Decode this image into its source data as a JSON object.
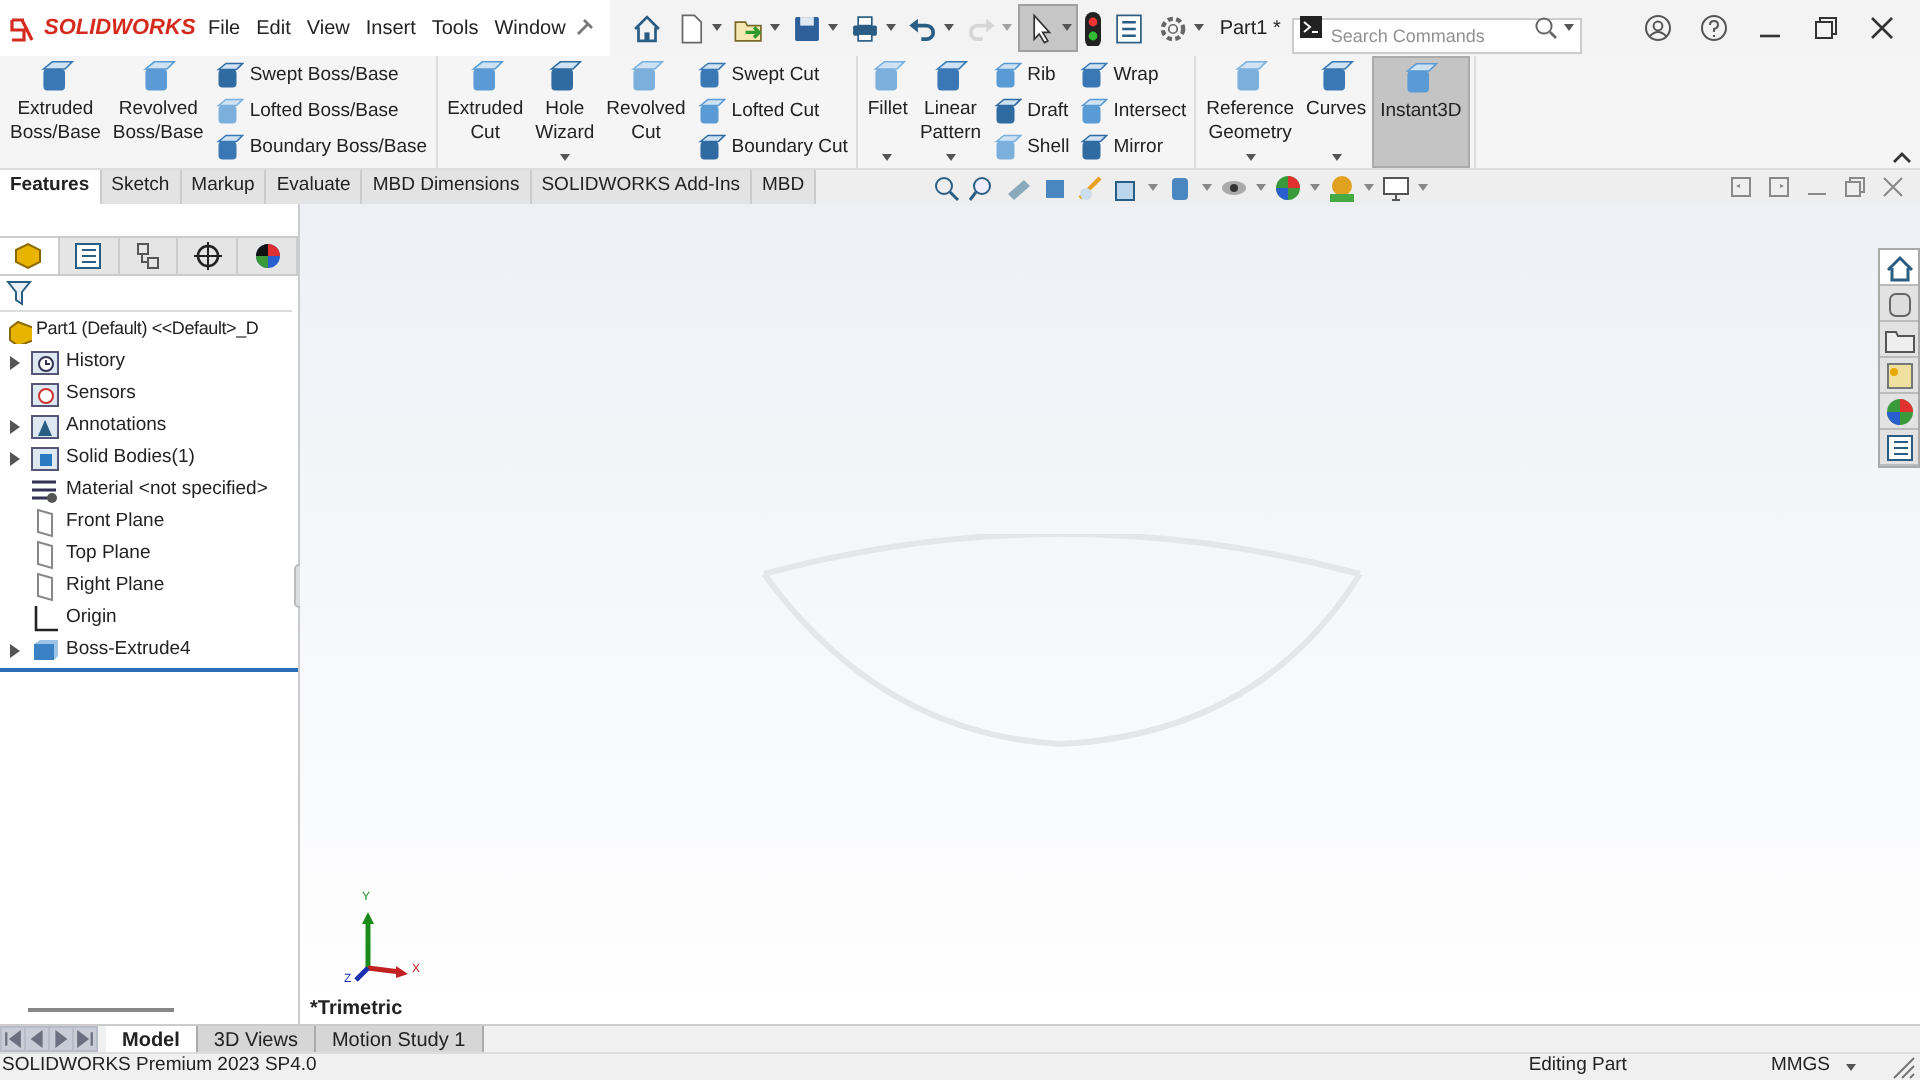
{
  "app": {
    "logo": "SOLIDWORKS"
  },
  "menu": [
    "File",
    "Edit",
    "View",
    "Insert",
    "Tools",
    "Window"
  ],
  "quick_access": [
    {
      "kind": "home",
      "pressed": false,
      "disabled": false,
      "dropdown": false
    },
    {
      "kind": "new",
      "pressed": false,
      "disabled": false,
      "dropdown": true
    },
    {
      "kind": "open",
      "pressed": false,
      "disabled": false,
      "dropdown": true
    },
    {
      "kind": "save",
      "pressed": false,
      "disabled": false,
      "dropdown": true
    },
    {
      "kind": "print",
      "pressed": false,
      "disabled": false,
      "dropdown": true
    },
    {
      "kind": "undo",
      "pressed": false,
      "disabled": false,
      "dropdown": true
    },
    {
      "kind": "redo",
      "pressed": false,
      "disabled": true,
      "dropdown": true
    },
    {
      "kind": "select",
      "pressed": true,
      "disabled": false,
      "dropdown": true
    },
    {
      "kind": "rebuild",
      "pressed": false,
      "disabled": false,
      "dropdown": false
    },
    {
      "kind": "properties",
      "pressed": false,
      "disabled": false,
      "dropdown": false
    },
    {
      "kind": "options",
      "pressed": false,
      "disabled": false,
      "dropdown": true
    }
  ],
  "document": "Part1 *",
  "search": {
    "placeholder": "Search Commands"
  },
  "ribbon": [
    {
      "items": [
        {
          "kind": "large",
          "lines": [
            "Extruded",
            "Boss/Base"
          ],
          "dropdown": false,
          "active": false
        },
        {
          "kind": "large",
          "lines": [
            "Revolved",
            "Boss/Base"
          ],
          "dropdown": false,
          "active": false
        },
        {
          "kind": "stack",
          "labels": [
            "Swept Boss/Base",
            "Lofted Boss/Base",
            "Boundary Boss/Base"
          ]
        }
      ]
    },
    {
      "items": [
        {
          "kind": "large",
          "lines": [
            "Extruded",
            "Cut"
          ],
          "dropdown": false,
          "active": false
        },
        {
          "kind": "large",
          "lines": [
            "Hole",
            "Wizard"
          ],
          "dropdown": true,
          "active": false
        },
        {
          "kind": "large",
          "lines": [
            "Revolved",
            "Cut"
          ],
          "dropdown": false,
          "active": false
        },
        {
          "kind": "stack",
          "labels": [
            "Swept Cut",
            "Lofted Cut",
            "Boundary Cut"
          ]
        }
      ]
    },
    {
      "items": [
        {
          "kind": "large",
          "lines": [
            "Fillet"
          ],
          "dropdown": true,
          "active": false
        },
        {
          "kind": "large",
          "lines": [
            "Linear",
            "Pattern"
          ],
          "dropdown": true,
          "active": false
        },
        {
          "kind": "stack",
          "labels": [
            "Rib",
            "Draft",
            "Shell"
          ]
        },
        {
          "kind": "stack",
          "labels": [
            "Wrap",
            "Intersect",
            "Mirror"
          ]
        }
      ]
    },
    {
      "items": [
        {
          "kind": "large",
          "lines": [
            "Reference",
            "Geometry"
          ],
          "dropdown": true,
          "active": false
        },
        {
          "kind": "large",
          "lines": [
            "Curves"
          ],
          "dropdown": true,
          "active": false
        },
        {
          "kind": "large",
          "lines": [
            "Instant3D"
          ],
          "dropdown": false,
          "active": true
        }
      ]
    }
  ],
  "tabs": [
    {
      "label": "Features",
      "selected": true
    },
    {
      "label": "Sketch",
      "selected": false
    },
    {
      "label": "Markup",
      "selected": false
    },
    {
      "label": "Evaluate",
      "selected": false
    },
    {
      "label": "MBD Dimensions",
      "selected": false
    },
    {
      "label": "SOLIDWORKS Add-Ins",
      "selected": false
    },
    {
      "label": "MBD",
      "selected": false
    }
  ],
  "panel_tabs": [
    {
      "kind": "feature",
      "selected": true
    },
    {
      "kind": "property",
      "selected": false
    },
    {
      "kind": "config",
      "selected": false
    },
    {
      "kind": "dim",
      "selected": false
    },
    {
      "kind": "display",
      "selected": false
    }
  ],
  "tree": {
    "root": "Part1 (Default) <<Default>_D",
    "items": [
      {
        "kind": "history",
        "label": "History",
        "expandable": true
      },
      {
        "kind": "sensor",
        "label": "Sensors",
        "expandable": false
      },
      {
        "kind": "annotation",
        "label": "Annotations",
        "expandable": true
      },
      {
        "kind": "body",
        "label": "Solid Bodies(1)",
        "expandable": true
      },
      {
        "kind": "material",
        "label": "Material <not specified>",
        "expandable": false
      },
      {
        "kind": "plane",
        "label": "Front Plane",
        "expandable": false
      },
      {
        "kind": "plane",
        "label": "Top Plane",
        "expandable": false
      },
      {
        "kind": "plane",
        "label": "Right Plane",
        "expandable": false
      },
      {
        "kind": "origin",
        "label": "Origin",
        "expandable": false
      },
      {
        "kind": "extrude",
        "label": "Boss-Extrude4",
        "expandable": true
      }
    ]
  },
  "viewport": {
    "view_name": "*Trimetric",
    "triad": {
      "x": "X",
      "y": "Y",
      "z": "Z"
    }
  },
  "task_pane": [
    {
      "kind": "home",
      "selected": true
    },
    {
      "kind": "library",
      "selected": false
    },
    {
      "kind": "folder",
      "selected": false
    },
    {
      "kind": "palette",
      "selected": false
    },
    {
      "kind": "appearance",
      "selected": false
    },
    {
      "kind": "properties",
      "selected": false
    }
  ],
  "bottom_tabs": [
    {
      "label": "Model",
      "selected": true
    },
    {
      "label": "3D Views",
      "selected": false
    },
    {
      "label": "Motion Study 1",
      "selected": false
    }
  ],
  "status_bar": {
    "product": "SOLIDWORKS Premium 2023 SP4.0",
    "mode": "Editing Part",
    "units": "MMGS"
  }
}
